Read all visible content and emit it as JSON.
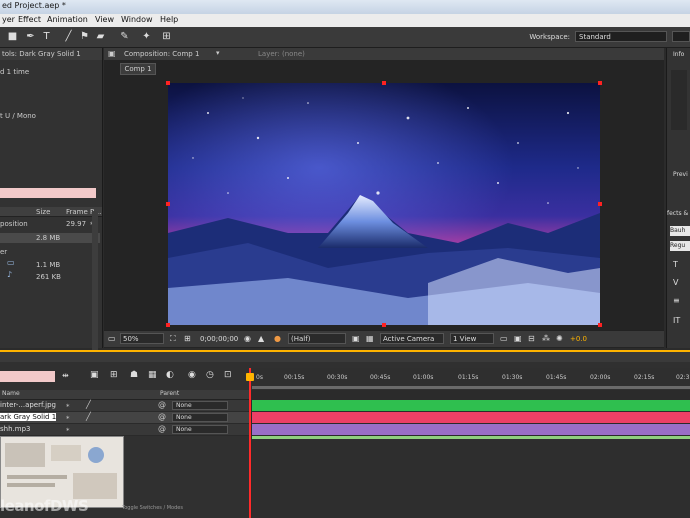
{
  "window": {
    "title": "ed Project.aep *"
  },
  "menu": [
    "yer",
    "Effect",
    "Animation",
    "View",
    "Window",
    "Help"
  ],
  "workspace": {
    "label": "Workspace:",
    "value": "Standard"
  },
  "project": {
    "header": "tols: Dark Gray Solid 1",
    "used": "d 1 time",
    "format": "t U / Mono",
    "columns": {
      "size": "Size",
      "frame_rate": "Frame R..."
    },
    "rows": [
      {
        "name": "position",
        "size": "",
        "rate": "29.97"
      },
      {
        "name": "",
        "size": "2.8 MB",
        "rate": ""
      },
      {
        "name": "er",
        "size": "",
        "rate": ""
      },
      {
        "name": "",
        "size": "1.1 MB",
        "rate": ""
      },
      {
        "name": "",
        "size": "261 KB",
        "rate": ""
      }
    ]
  },
  "viewer": {
    "tab": "Composition: Comp 1",
    "layer_tab": "Layer: (none)",
    "comp_chip": "Comp 1",
    "zoom": "50%",
    "timecode": "0;00;00;00",
    "resolution": "(Half)",
    "camera": "Active Camera",
    "views": "1 View",
    "exposure": "+0.0"
  },
  "right_panel": {
    "info": "Info",
    "preview": "Previ",
    "effects": "fects &",
    "field1": "Bauh",
    "field2": "Regu"
  },
  "timeline": {
    "ticks": [
      "0s",
      "00:15s",
      "00:30s",
      "00:45s",
      "01:00s",
      "01:15s",
      "01:30s",
      "01:45s",
      "02:00s",
      "02:15s",
      "02:3"
    ],
    "head_name": "Name",
    "head_parent": "Parent",
    "layers": [
      {
        "name": "inter-...aperf.jpg",
        "parent": "None",
        "color": "#2fbf4f"
      },
      {
        "name": "ark Gray Solid 1",
        "parent": "None",
        "color": "#ec4066"
      },
      {
        "name": "shh.mp3",
        "parent": "None",
        "color": "#9a6fc7"
      }
    ],
    "bottom_layer_color": "#8fd17f",
    "toggle": "Toggle Switches / Modes"
  },
  "watermark": "leanofDWS",
  "colors": {
    "accent": "#ffb400",
    "handle": "#ff2222"
  }
}
